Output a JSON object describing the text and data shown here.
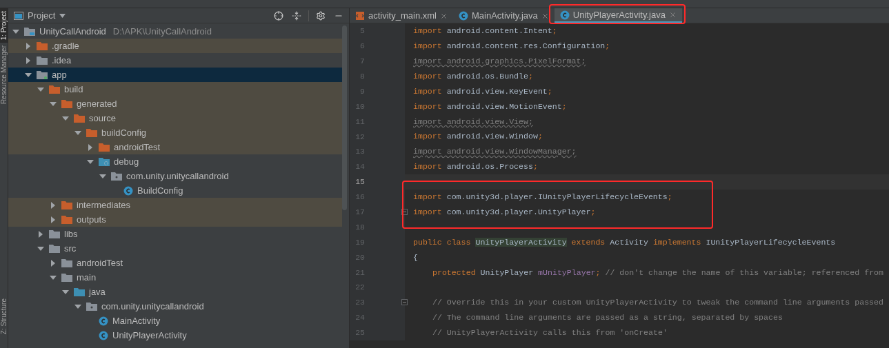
{
  "tool_stripe": [
    {
      "label": "1: Project",
      "kind": "project",
      "selected": true
    },
    {
      "label": "Resource Manager",
      "kind": "resources",
      "selected": false
    },
    {
      "label": "Z: Structure",
      "kind": "structure",
      "selected": false
    }
  ],
  "project_panel": {
    "title": "Project",
    "tree": [
      {
        "label": "UnityCallAndroid",
        "path": "D:\\APK\\UnityCallAndroid",
        "kind": "project",
        "expanded": true,
        "selected": false,
        "excluded": false,
        "children": [
          {
            "label": ".gradle",
            "kind": "generated",
            "expanded": false,
            "selected": false,
            "excluded": true
          },
          {
            "label": ".idea",
            "kind": "folder",
            "expanded": false,
            "selected": false,
            "excluded": false
          },
          {
            "label": "app",
            "kind": "module",
            "expanded": true,
            "selected": true,
            "excluded": false,
            "children": [
              {
                "label": "build",
                "kind": "generated",
                "expanded": true,
                "selected": false,
                "excluded": true,
                "children": [
                  {
                    "label": "generated",
                    "kind": "generated",
                    "expanded": true,
                    "selected": false,
                    "excluded": true,
                    "children": [
                      {
                        "label": "source",
                        "kind": "generated",
                        "expanded": true,
                        "selected": false,
                        "excluded": true,
                        "children": [
                          {
                            "label": "buildConfig",
                            "kind": "generated",
                            "expanded": true,
                            "selected": false,
                            "excluded": true,
                            "children": [
                              {
                                "label": "androidTest",
                                "kind": "generated",
                                "expanded": false,
                                "selected": false,
                                "excluded": true
                              },
                              {
                                "label": "debug",
                                "kind": "gen-source",
                                "expanded": true,
                                "selected": false,
                                "excluded": false,
                                "children": [
                                  {
                                    "label": "com.unity.unitycallandroid",
                                    "kind": "package",
                                    "expanded": true,
                                    "selected": false,
                                    "excluded": false,
                                    "children": [
                                      {
                                        "label": "BuildConfig",
                                        "kind": "class",
                                        "selected": false,
                                        "excluded": false
                                      }
                                    ]
                                  }
                                ]
                              }
                            ]
                          }
                        ]
                      }
                    ]
                  },
                  {
                    "label": "intermediates",
                    "kind": "generated",
                    "expanded": false,
                    "selected": false,
                    "excluded": true
                  },
                  {
                    "label": "outputs",
                    "kind": "generated",
                    "expanded": false,
                    "selected": false,
                    "excluded": true
                  }
                ]
              },
              {
                "label": "libs",
                "kind": "folder",
                "expanded": false,
                "selected": false,
                "excluded": false
              },
              {
                "label": "src",
                "kind": "folder",
                "expanded": true,
                "selected": false,
                "excluded": false,
                "children": [
                  {
                    "label": "androidTest",
                    "kind": "folder",
                    "expanded": false,
                    "selected": false,
                    "excluded": false
                  },
                  {
                    "label": "main",
                    "kind": "folder",
                    "expanded": true,
                    "selected": false,
                    "excluded": false,
                    "children": [
                      {
                        "label": "java",
                        "kind": "source",
                        "expanded": true,
                        "selected": false,
                        "excluded": false,
                        "children": [
                          {
                            "label": "com.unity.unitycallandroid",
                            "kind": "package",
                            "expanded": true,
                            "selected": false,
                            "excluded": false,
                            "children": [
                              {
                                "label": "MainActivity",
                                "kind": "class",
                                "selected": false,
                                "excluded": false
                              },
                              {
                                "label": "UnityPlayerActivity",
                                "kind": "class",
                                "selected": false,
                                "excluded": false
                              }
                            ]
                          }
                        ]
                      }
                    ]
                  }
                ]
              }
            ]
          }
        ]
      }
    ]
  },
  "editor": {
    "tabs": [
      {
        "label": "activity_main.xml",
        "kind": "layout",
        "selected": false
      },
      {
        "label": "MainActivity.java",
        "kind": "class",
        "selected": false
      },
      {
        "label": "UnityPlayerActivity.java",
        "kind": "class",
        "selected": true
      }
    ],
    "lines": [
      {
        "number": "5",
        "current": false,
        "tokens": [
          {
            "kind": "keyword",
            "text": "import"
          },
          {
            "kind": "plain",
            "text": " android.content.Intent"
          },
          {
            "kind": "punct",
            "text": ";"
          }
        ]
      },
      {
        "number": "6",
        "current": false,
        "tokens": [
          {
            "kind": "keyword",
            "text": "import"
          },
          {
            "kind": "plain",
            "text": " android.content.res.Configuration"
          },
          {
            "kind": "punct",
            "text": ";"
          }
        ]
      },
      {
        "number": "7",
        "current": false,
        "tokens": [
          {
            "kind": "unused",
            "text": "import android.graphics.PixelFormat;"
          }
        ]
      },
      {
        "number": "8",
        "current": false,
        "tokens": [
          {
            "kind": "keyword",
            "text": "import"
          },
          {
            "kind": "plain",
            "text": " android.os.Bundle"
          },
          {
            "kind": "punct",
            "text": ";"
          }
        ]
      },
      {
        "number": "9",
        "current": false,
        "tokens": [
          {
            "kind": "keyword",
            "text": "import"
          },
          {
            "kind": "plain",
            "text": " android.view.KeyEvent"
          },
          {
            "kind": "punct",
            "text": ";"
          }
        ]
      },
      {
        "number": "10",
        "current": false,
        "tokens": [
          {
            "kind": "keyword",
            "text": "import"
          },
          {
            "kind": "plain",
            "text": " android.view.MotionEvent"
          },
          {
            "kind": "punct",
            "text": ";"
          }
        ]
      },
      {
        "number": "11",
        "current": false,
        "tokens": [
          {
            "kind": "unused",
            "text": "import android.view.View;"
          }
        ]
      },
      {
        "number": "12",
        "current": false,
        "tokens": [
          {
            "kind": "keyword",
            "text": "import"
          },
          {
            "kind": "plain",
            "text": " android.view.Window"
          },
          {
            "kind": "punct",
            "text": ";"
          }
        ]
      },
      {
        "number": "13",
        "current": false,
        "tokens": [
          {
            "kind": "unused",
            "text": "import android.view.WindowManager;"
          }
        ]
      },
      {
        "number": "14",
        "current": false,
        "tokens": [
          {
            "kind": "keyword",
            "text": "import"
          },
          {
            "kind": "plain",
            "text": " android.os.Process"
          },
          {
            "kind": "punct",
            "text": ";"
          }
        ]
      },
      {
        "number": "15",
        "current": true
      },
      {
        "number": "16",
        "current": false,
        "tokens": [
          {
            "kind": "keyword",
            "text": "import"
          },
          {
            "kind": "plain",
            "text": " com.unity3d.player.IUnityPlayerLifecycleEvents"
          },
          {
            "kind": "punct",
            "text": ";"
          }
        ]
      },
      {
        "number": "17",
        "current": false,
        "fold": true,
        "tokens": [
          {
            "kind": "keyword",
            "text": "import"
          },
          {
            "kind": "plain",
            "text": " com.unity3d.player.UnityPlayer"
          },
          {
            "kind": "punct",
            "text": ";"
          }
        ]
      },
      {
        "number": "18",
        "current": false
      },
      {
        "number": "19",
        "current": false,
        "tokens": [
          {
            "kind": "keyword",
            "text": "public class "
          },
          {
            "kind": "usage",
            "text": "UnityPlayerActivity"
          },
          {
            "kind": "keyword",
            "text": " extends "
          },
          {
            "kind": "plain",
            "text": "Activity "
          },
          {
            "kind": "keyword",
            "text": "implements "
          },
          {
            "kind": "plain",
            "text": "IUnityPlayerLifecycleEvents"
          }
        ]
      },
      {
        "number": "20",
        "current": false,
        "tokens": [
          {
            "kind": "plain",
            "text": "{"
          }
        ]
      },
      {
        "number": "21",
        "current": false,
        "indented": true,
        "tokens": [
          {
            "kind": "keyword",
            "text": "protected "
          },
          {
            "kind": "plain",
            "text": "UnityPlayer "
          },
          {
            "kind": "field",
            "text": "mUnityPlayer"
          },
          {
            "kind": "punct",
            "text": "; "
          },
          {
            "kind": "comment",
            "text": "// don't change the name of this variable; referenced from"
          }
        ]
      },
      {
        "number": "22",
        "current": false
      },
      {
        "number": "23",
        "current": false,
        "fold": true,
        "indented": true,
        "tokens": [
          {
            "kind": "comment",
            "text": "// Override this in your custom UnityPlayerActivity to tweak the command line arguments passed"
          }
        ]
      },
      {
        "number": "24",
        "current": false,
        "indented": true,
        "tokens": [
          {
            "kind": "comment",
            "text": "// The command line arguments are passed as a string, separated by spaces"
          }
        ]
      },
      {
        "number": "25",
        "current": false,
        "indented": true,
        "tokens": [
          {
            "kind": "comment",
            "text": "// UnityPlayerActivity calls this from 'onCreate'"
          }
        ]
      }
    ]
  }
}
